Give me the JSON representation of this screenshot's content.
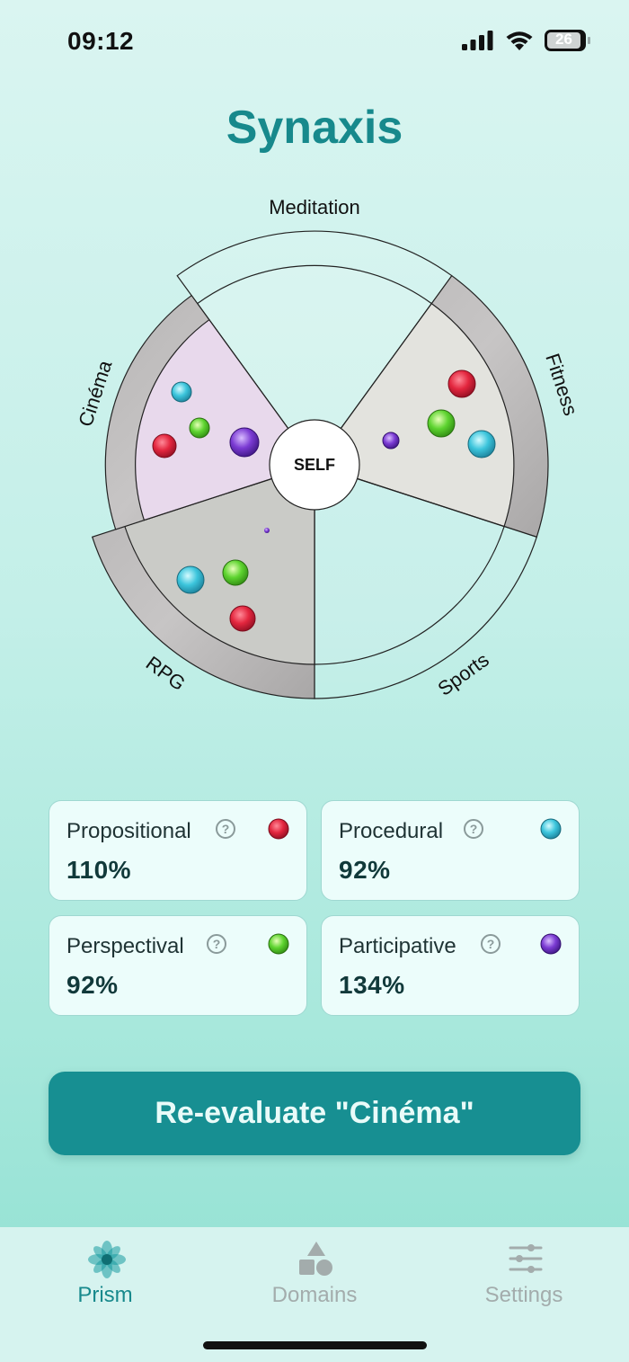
{
  "status_bar": {
    "time": "09:12",
    "battery": "26"
  },
  "app": {
    "title": "Synaxis"
  },
  "wheel": {
    "center_label": "SELF",
    "domains": [
      {
        "name": "Meditation"
      },
      {
        "name": "Fitness"
      },
      {
        "name": "Sports"
      },
      {
        "name": "RPG"
      },
      {
        "name": "Cinéma"
      }
    ]
  },
  "metrics": [
    {
      "label": "Propositional",
      "value": "110%",
      "gem": "red-gem-icon",
      "color": "#e0263e"
    },
    {
      "label": "Procedural",
      "value": "92%",
      "gem": "cyan-gem-icon",
      "color": "#36bfd6"
    },
    {
      "label": "Perspectival",
      "value": "92%",
      "gem": "green-gem-icon",
      "color": "#5bd12f"
    },
    {
      "label": "Participative",
      "value": "134%",
      "gem": "purple-gem-icon",
      "color": "#7a3ad1"
    }
  ],
  "actions": {
    "reevaluate_label": "Re-evaluate \"Cinéma\""
  },
  "tabbar": {
    "tabs": [
      {
        "label": "Prism",
        "icon": "prism-flower-icon",
        "active": true
      },
      {
        "label": "Domains",
        "icon": "shapes-icon",
        "active": false
      },
      {
        "label": "Settings",
        "icon": "sliders-icon",
        "active": false
      }
    ]
  },
  "colors": {
    "accent": "#17898c",
    "gem_red": "#e0263e",
    "gem_cyan": "#36bfd6",
    "gem_green": "#5bd12f",
    "gem_purple": "#7a3ad1"
  }
}
